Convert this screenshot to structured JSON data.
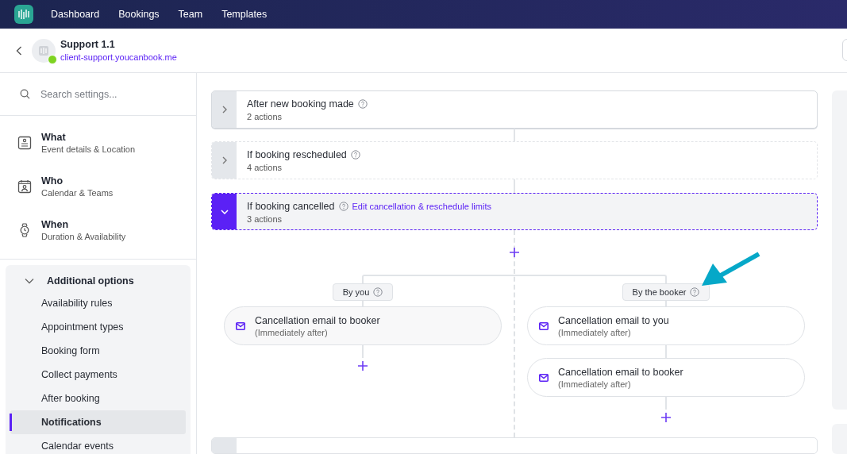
{
  "nav": {
    "items": [
      "Dashboard",
      "Bookings",
      "Team",
      "Templates"
    ]
  },
  "header": {
    "title": "Support 1.1",
    "url": "client-support.youcanbook.me",
    "online": true
  },
  "sidebar": {
    "search": {
      "placeholder": "Search settings..."
    },
    "sections": [
      {
        "title": "What",
        "subtitle": "Event details & Location"
      },
      {
        "title": "Who",
        "subtitle": "Calendar & Teams"
      },
      {
        "title": "When",
        "subtitle": "Duration & Availability"
      }
    ],
    "additional": {
      "title": "Additional options",
      "expanded": true,
      "items": [
        {
          "label": "Availability rules",
          "selected": false
        },
        {
          "label": "Appointment types",
          "selected": false
        },
        {
          "label": "Booking form",
          "selected": false
        },
        {
          "label": "Collect payments",
          "selected": false
        },
        {
          "label": "After booking",
          "selected": false
        },
        {
          "label": "Notifications",
          "selected": true
        },
        {
          "label": "Calendar events",
          "selected": false
        }
      ]
    }
  },
  "triggers": [
    {
      "title": "After new booking made",
      "count": "2 actions",
      "expanded": false,
      "active": true
    },
    {
      "title": "If booking rescheduled",
      "count": "4 actions",
      "expanded": false,
      "active": false
    },
    {
      "title": "If booking cancelled",
      "count": "3 actions",
      "expanded": true,
      "active": false,
      "link": "Edit cancellation & reschedule limits"
    }
  ],
  "branches": [
    {
      "label": "By you",
      "actions": [
        {
          "title": "Cancellation email to booker",
          "timing": "(Immediately after)"
        }
      ]
    },
    {
      "label": "By the booker",
      "actions": [
        {
          "title": "Cancellation email to you",
          "timing": "(Immediately after)"
        },
        {
          "title": "Cancellation email to booker",
          "timing": "(Immediately after)"
        }
      ]
    }
  ]
}
